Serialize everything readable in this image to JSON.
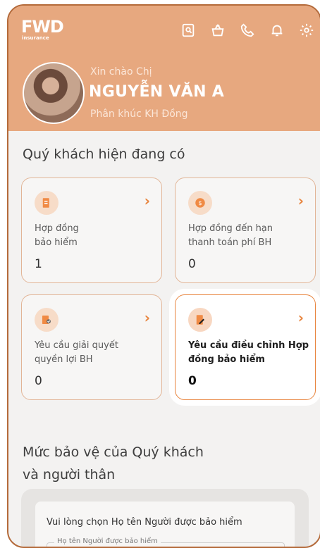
{
  "header": {
    "logo_text": "FWD",
    "logo_sub": "insurance",
    "greeting": "Xin chào Chị",
    "name": "NGUYỄN VĂN A",
    "segment": "Phân khúc KH Đồng",
    "icons": [
      "search-document-icon",
      "package-icon",
      "phone-icon",
      "bell-icon",
      "gear-icon"
    ]
  },
  "main": {
    "section_title": "Quý khách hiện đang có",
    "cards": [
      {
        "label": "Hợp đồng\nbảo hiểm",
        "count": "1",
        "icon": "document-icon"
      },
      {
        "label": "Hợp đồng đến hạn\nthanh toán phí BH",
        "count": "0",
        "icon": "dollar-icon"
      },
      {
        "label": "Yêu cầu giải quyết\nquyền lợi BH",
        "count": "0",
        "icon": "claim-check-icon"
      },
      {
        "label": "Yêu cầu điều chỉnh Hợp\nđồng bảo hiểm",
        "count": "0",
        "icon": "edit-document-icon"
      }
    ],
    "protection_title": "Mức bảo vệ của Quý khách\nvà người thân",
    "select_prompt": "Vui lòng chọn Họ tên Người được bảo hiểm",
    "field_label": "Họ tên Người được bảo hiểm"
  },
  "colors": {
    "header_bg": "#e7a87f",
    "accent": "#e8853f",
    "frame": "#b46a3a"
  }
}
